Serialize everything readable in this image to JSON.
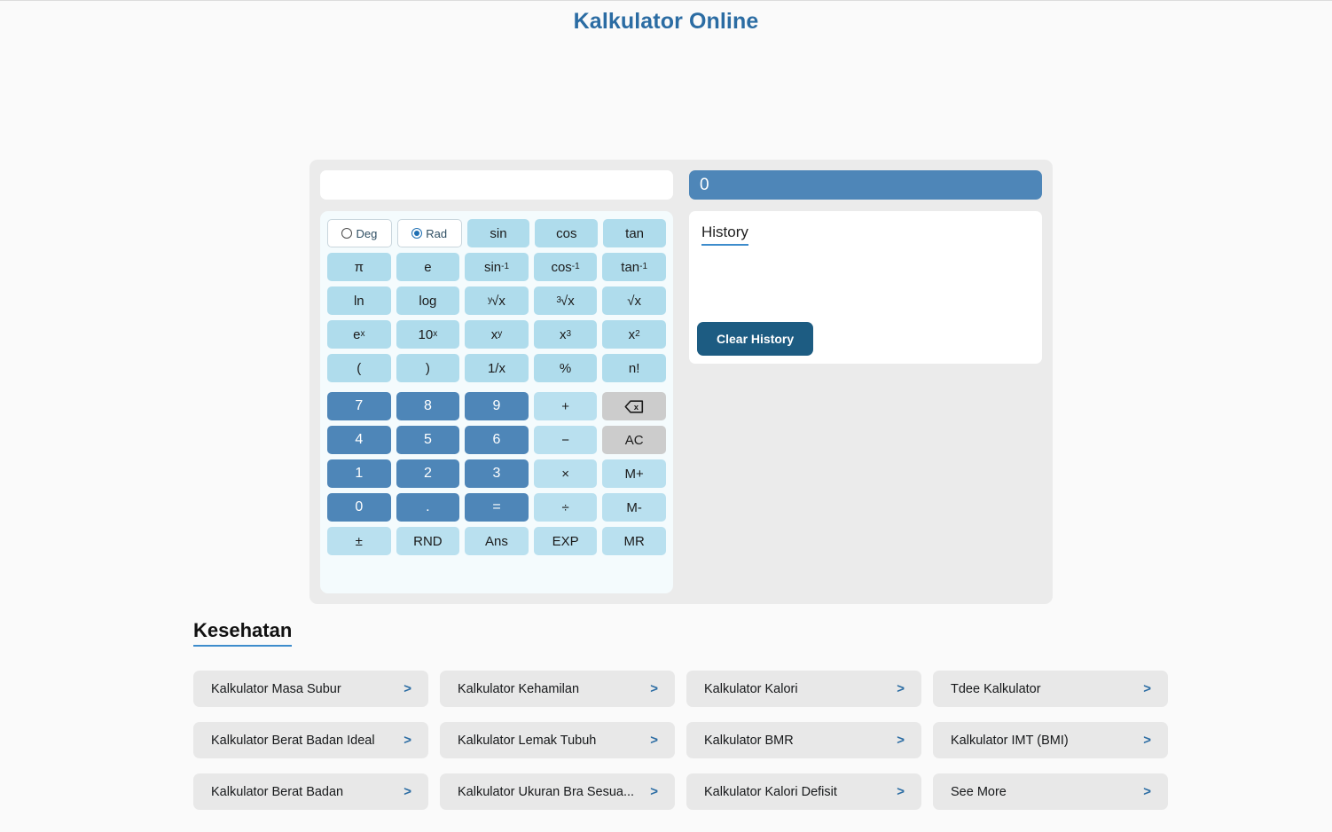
{
  "page": {
    "title": "Kalkulator Online"
  },
  "calculator": {
    "expression_value": "",
    "expression_placeholder": "",
    "display_value": "0",
    "angle_modes": [
      {
        "label": "Deg",
        "selected": false,
        "icon": "radio-unselected-icon"
      },
      {
        "label": "Rad",
        "selected": true,
        "icon": "radio-selected-icon"
      }
    ],
    "function_keys": [
      "sin",
      "cos",
      "tan",
      "π",
      "e",
      "sin⁻¹",
      "cos⁻¹",
      "tan⁻¹",
      "ln",
      "log",
      "ʸ√x",
      "³√x",
      "√x",
      "eˣ",
      "10ˣ",
      "xʸ",
      "x³",
      "x²",
      "(",
      ")",
      "1/x",
      "%",
      "n!"
    ],
    "rows": {
      "r1": {
        "k1": "sin",
        "k2": "cos",
        "k3": "tan"
      },
      "r2": {
        "k1": "π",
        "k2": "e",
        "k3": "sin",
        "k3sup": "-1",
        "k4": "cos",
        "k4sup": "-1",
        "k5": "tan",
        "k5sup": "-1"
      },
      "r3": {
        "k1": "ln",
        "k2": "log",
        "k3pre": "y",
        "k3": "√x",
        "k4pre": "3",
        "k4": "√x",
        "k5": "√x"
      },
      "r4": {
        "k1": "e",
        "k1sup": "x",
        "k2": "10",
        "k2sup": "x",
        "k3": "x",
        "k3sup": "y",
        "k4": "x",
        "k4sup": "3",
        "k5": "x",
        "k5sup": "2"
      },
      "r5": {
        "k1": "(",
        "k2": ")",
        "k3": "1/x",
        "k4": "%",
        "k5": "n!"
      },
      "r6": {
        "k1": "7",
        "k2": "8",
        "k3": "9",
        "k4": "+",
        "k5": "backspace"
      },
      "r7": {
        "k1": "4",
        "k2": "5",
        "k3": "6",
        "k4": "−",
        "k5": "AC"
      },
      "r8": {
        "k1": "1",
        "k2": "2",
        "k3": "3",
        "k4": "×",
        "k5": "M+"
      },
      "r9": {
        "k1": "0",
        "k2": ".",
        "k3": "=",
        "k4": "÷",
        "k5": "M-"
      },
      "r10": {
        "k1": "±",
        "k2": "RND",
        "k3": "Ans",
        "k4": "EXP",
        "k5": "MR"
      }
    },
    "history": {
      "label": "History",
      "entries": "",
      "clear_button": "Clear History"
    },
    "colors": {
      "digit_key": "#4e86b8",
      "function_key": "#afdcec",
      "operator_key": "#b9e0ef",
      "utility_key": "#cccccc",
      "display_bg": "#4e86b8",
      "clear_button": "#1d5c82",
      "accent": "#2b6ca3"
    }
  },
  "links_section": {
    "title": "Kesehatan",
    "chevron": ">",
    "items": [
      {
        "label": "Kalkulator Masa Subur"
      },
      {
        "label": "Kalkulator Kehamilan"
      },
      {
        "label": "Kalkulator Kalori"
      },
      {
        "label": "Tdee Kalkulator"
      },
      {
        "label": "Kalkulator Berat Badan Ideal"
      },
      {
        "label": "Kalkulator Lemak Tubuh"
      },
      {
        "label": "Kalkulator BMR"
      },
      {
        "label": "Kalkulator IMT (BMI)"
      },
      {
        "label": "Kalkulator Berat Badan"
      },
      {
        "label": "Kalkulator Ukuran Bra Sesua..."
      },
      {
        "label": "Kalkulator Kalori Defisit"
      },
      {
        "label": "See More"
      }
    ]
  }
}
